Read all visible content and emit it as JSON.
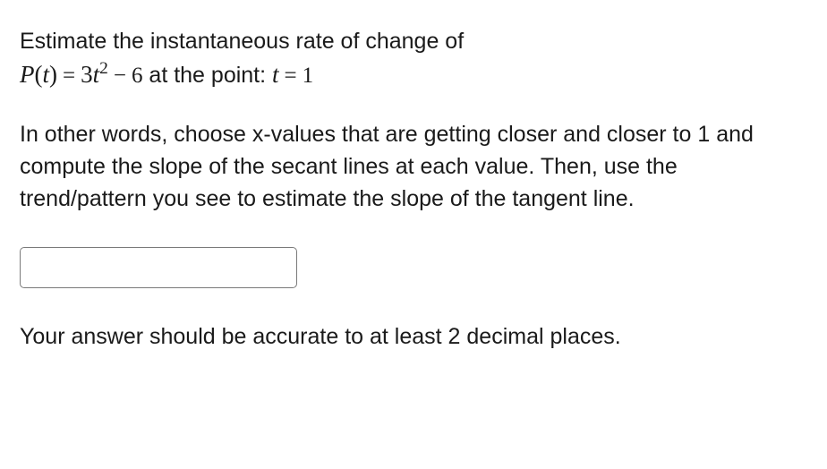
{
  "question": {
    "prompt_intro": "Estimate the instantaneous rate of change of",
    "function_name": "P",
    "function_var": "t",
    "coef": "3",
    "var_base": "t",
    "exponent": "2",
    "constant": "6",
    "prompt_point_prefix": " at the point: ",
    "point_var": "t",
    "point_value": "1",
    "explanation": "In other words, choose x-values that are getting closer and closer to 1 and compute the slope of the secant lines at each value. Then, use the trend/pattern you see to estimate the slope of the tangent line.",
    "answer_value": "",
    "accuracy_note": "Your answer should be accurate to at least 2 decimal places."
  }
}
